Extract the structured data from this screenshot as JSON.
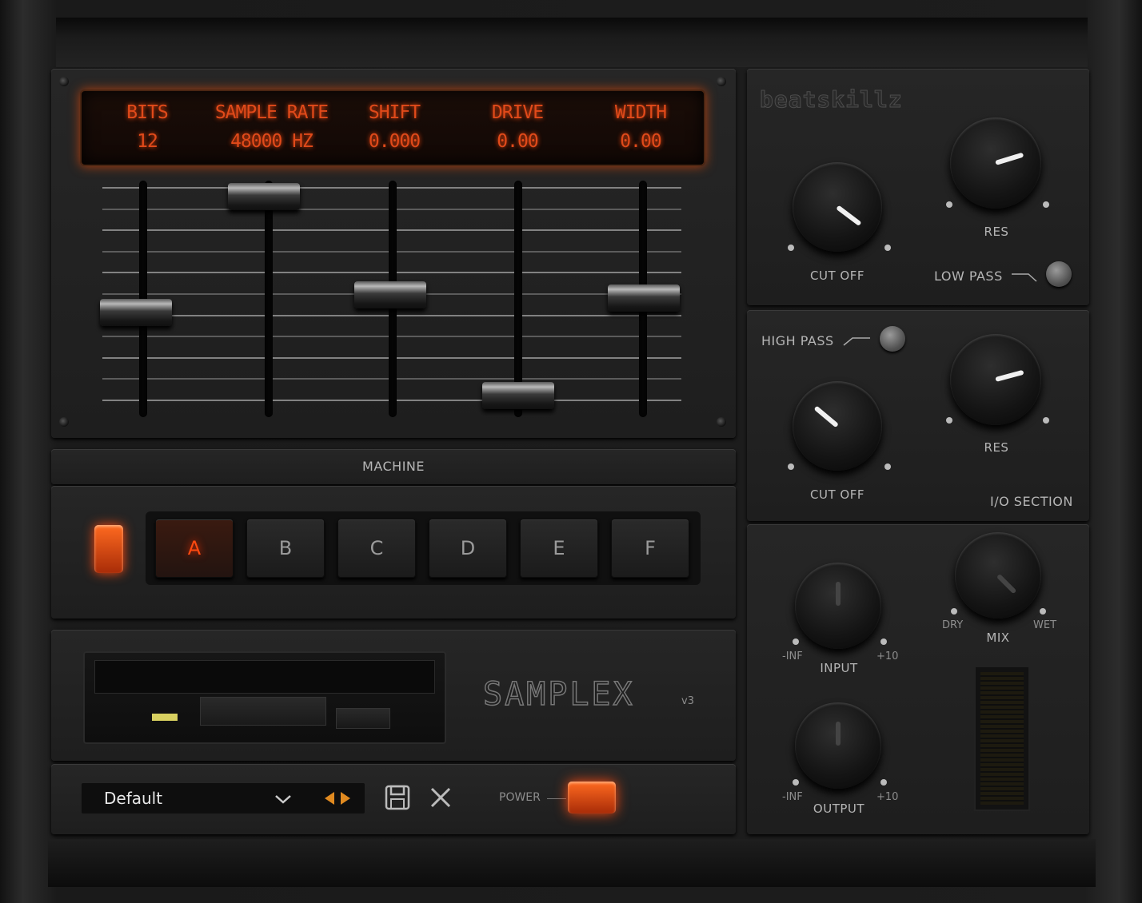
{
  "brand": "beatskillz",
  "lcd": [
    {
      "label": "BITS",
      "value": "12"
    },
    {
      "label": "SAMPLE RATE",
      "value": "48000 HZ"
    },
    {
      "label": "SHIFT",
      "value": "0.000"
    },
    {
      "label": "DRIVE",
      "value": "0.00"
    },
    {
      "label": "WIDTH",
      "value": "0.00"
    }
  ],
  "machine": {
    "title": "MACHINE",
    "buttons": [
      "A",
      "B",
      "C",
      "D",
      "E",
      "F"
    ],
    "selected": "A"
  },
  "product": {
    "name": "SAMPLEX",
    "version": "v3"
  },
  "preset": {
    "name": "Default"
  },
  "power": {
    "label": "POWER",
    "state": "on"
  },
  "filters": {
    "low_pass": {
      "label": "LOW PASS",
      "cutoff_label": "CUT OFF",
      "res_label": "RES"
    },
    "high_pass": {
      "label": "HIGH PASS",
      "cutoff_label": "CUT OFF",
      "res_label": "RES"
    }
  },
  "io": {
    "title": "I/O SECTION",
    "input": {
      "label": "INPUT",
      "min": "-INF",
      "max": "+10"
    },
    "output": {
      "label": "OUTPUT",
      "min": "-INF",
      "max": "+10"
    },
    "mix": {
      "label": "MIX",
      "min": "DRY",
      "max": "WET"
    }
  },
  "colors": {
    "accent": "#ff4a10",
    "lcd": "#e04a1a",
    "floppy_led": "#d8d060"
  }
}
